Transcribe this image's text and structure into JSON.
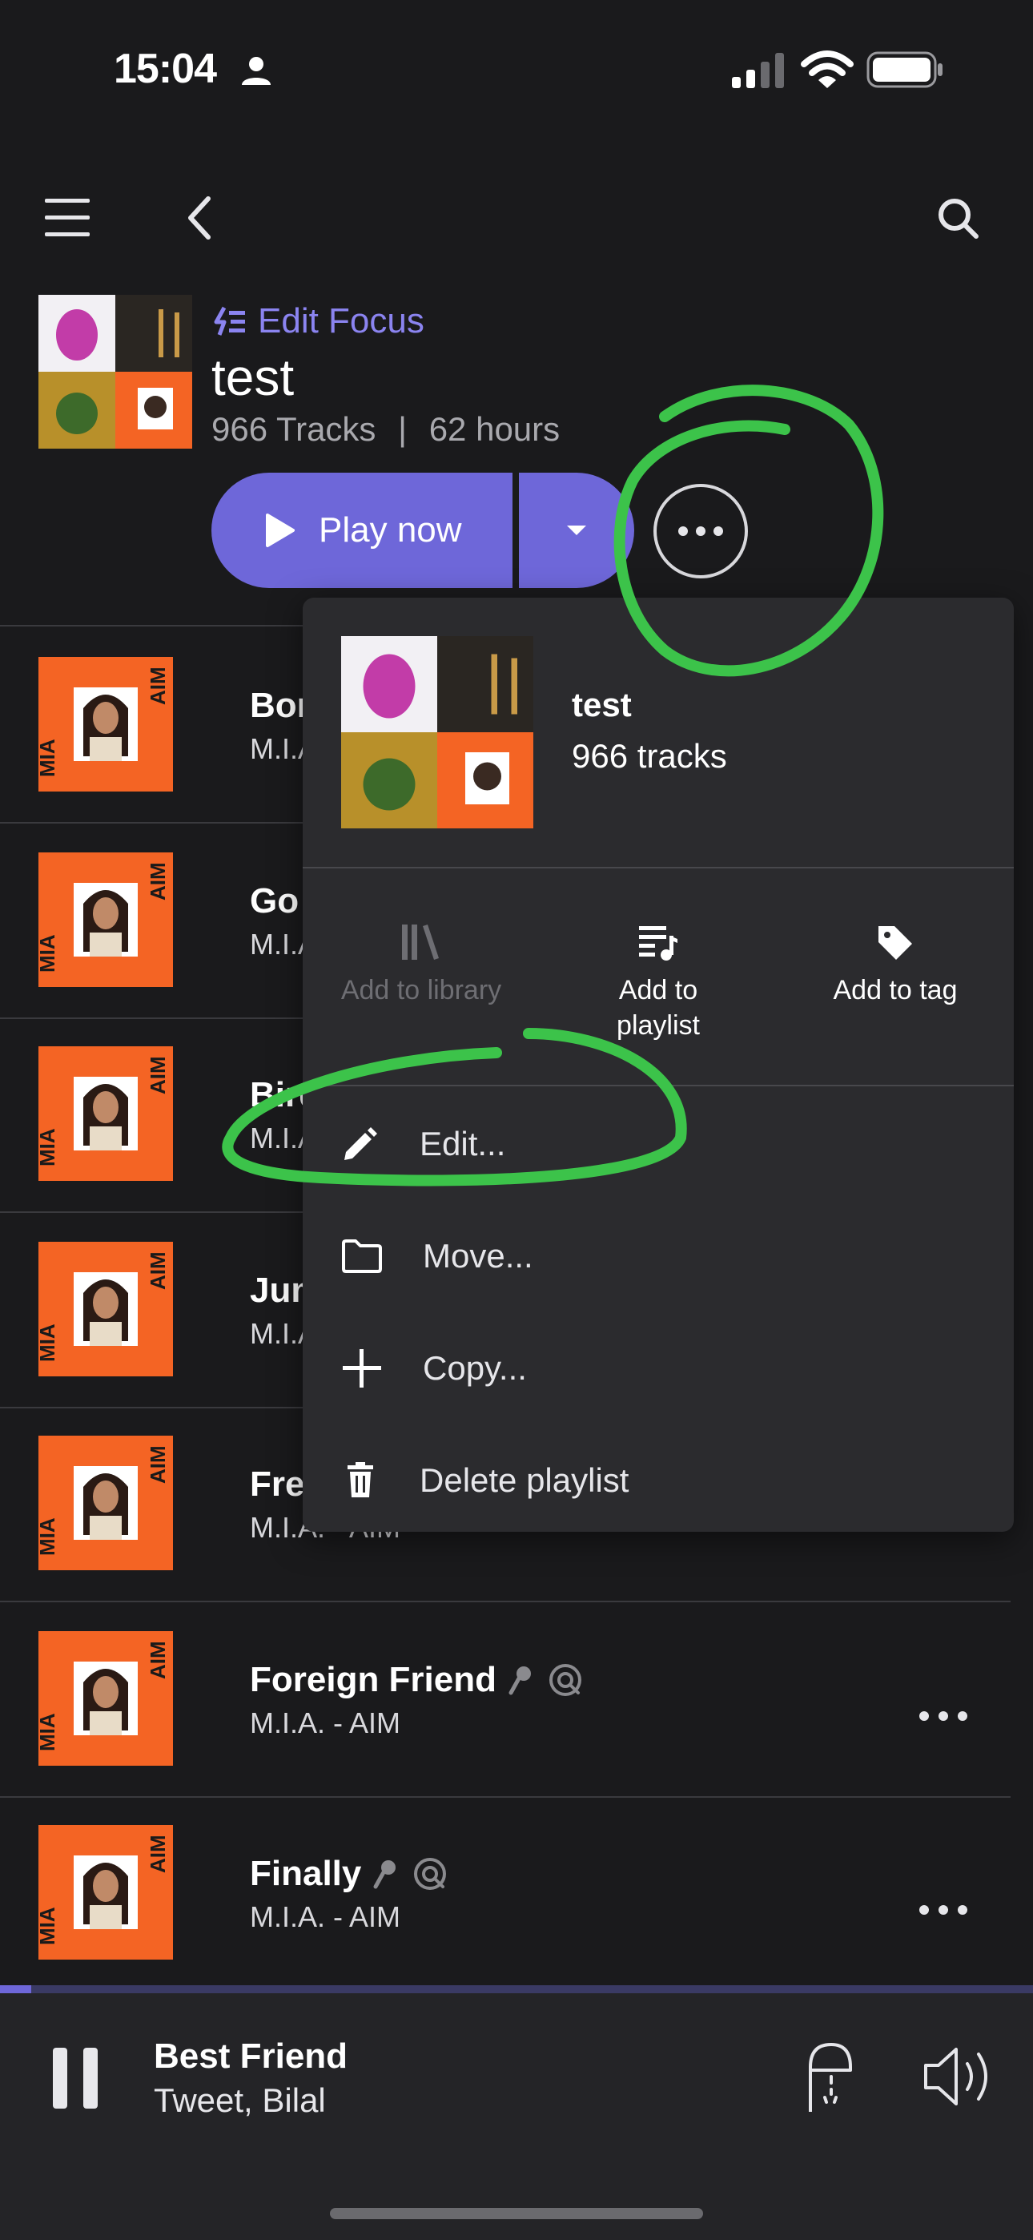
{
  "status_bar": {
    "time": "15:04"
  },
  "header": {
    "edit_focus_label": "Edit Focus",
    "playlist_title": "test",
    "track_count": "966 Tracks",
    "separator": "|",
    "duration": "62 hours",
    "play_now_label": "Play now"
  },
  "tracks": [
    {
      "title": "Bor",
      "subtitle": "M.I.A"
    },
    {
      "title": "Go",
      "subtitle": "M.I.A"
    },
    {
      "title": "Bird",
      "subtitle": "M.I.A"
    },
    {
      "title": "Jum",
      "subtitle": "M.I.A"
    },
    {
      "title": "Free",
      "subtitle": "M.I.A. - AIM"
    },
    {
      "title": "Foreign Friend",
      "subtitle": "M.I.A. - AIM"
    },
    {
      "title": "Finally",
      "subtitle": "M.I.A. - AIM"
    }
  ],
  "album_art": {
    "left_label": "MIA",
    "right_label": "AIM",
    "bg_color": "#f46424"
  },
  "context_menu": {
    "title": "test",
    "subtitle": "966 tracks",
    "actions": {
      "add_to_library": "Add to library",
      "add_to_playlist_line1": "Add to",
      "add_to_playlist_line2": "playlist",
      "add_to_tag": "Add to tag"
    },
    "items": {
      "edit": "Edit...",
      "move": "Move...",
      "copy": "Copy...",
      "delete": "Delete playlist"
    }
  },
  "now_playing": {
    "title": "Best Friend",
    "artist": "Tweet, Bilal",
    "progress": 0.03
  },
  "colors": {
    "accent": "#6e67d9",
    "edit_focus": "#8b84f0",
    "annotation": "#3cc34a",
    "background": "#1a1a1c",
    "menu_bg": "#2b2b2e"
  },
  "icons": [
    "menu-icon",
    "back-icon",
    "search-icon",
    "play-icon",
    "dropdown-icon",
    "more-icon",
    "library-icon",
    "playlist-add-icon",
    "tag-icon",
    "pencil-icon",
    "folder-icon",
    "plus-icon",
    "trash-icon",
    "pause-icon",
    "cast-icon",
    "volume-icon",
    "microphone-icon",
    "sonic-icon"
  ]
}
